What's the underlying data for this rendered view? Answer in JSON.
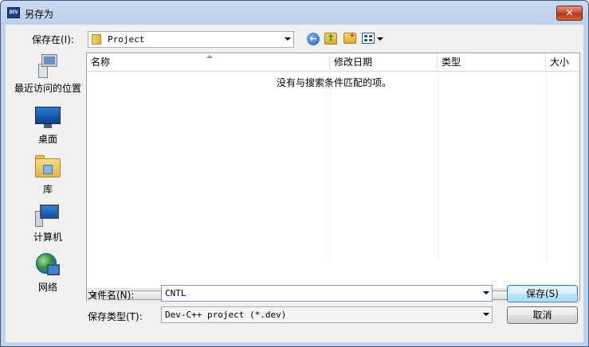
{
  "window": {
    "title": "另存为",
    "app_icon_text": "DEV",
    "close_glyph": "✕"
  },
  "toolbar": {
    "save_in_label": "保存在(I):",
    "save_in_value": "Project",
    "icons": [
      "back-icon",
      "up-folder-icon",
      "new-folder-icon",
      "views-icon"
    ]
  },
  "places": [
    {
      "id": "recent",
      "label": "最近访问的位置",
      "icon": "recent-places-icon"
    },
    {
      "id": "desktop",
      "label": "桌面",
      "icon": "desktop-icon"
    },
    {
      "id": "library",
      "label": "库",
      "icon": "library-icon"
    },
    {
      "id": "computer",
      "label": "计算机",
      "icon": "computer-icon"
    },
    {
      "id": "network",
      "label": "网络",
      "icon": "network-icon"
    }
  ],
  "filelist": {
    "columns": [
      "名称",
      "修改日期",
      "类型",
      "大小"
    ],
    "empty_message": "没有与搜索条件匹配的项。",
    "rows": []
  },
  "form": {
    "filename_label": "文件名(N):",
    "filename_value": "CNTL",
    "filetype_label": "保存类型(T):",
    "filetype_value": "Dev-C++ project (*.dev)"
  },
  "buttons": {
    "save": "保存(S)",
    "cancel": "取消"
  },
  "colors": {
    "title_bar": "#c9d9ee",
    "close_button": "#c8472f",
    "default_button_border": "#3c7fb1"
  }
}
